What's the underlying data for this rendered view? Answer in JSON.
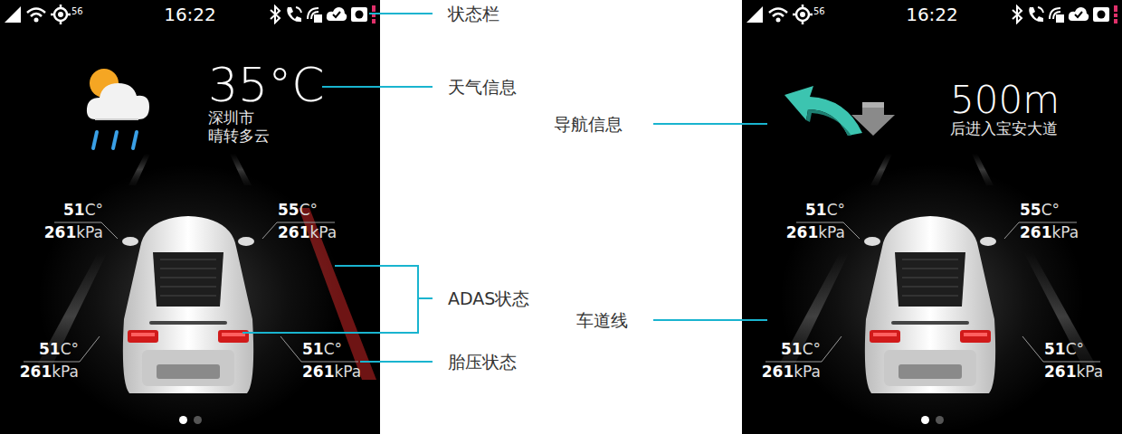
{
  "screens": [
    {
      "status_bar": {
        "signal": "56",
        "time": "16:22"
      },
      "info": {
        "kind": "weather",
        "main": "35°C",
        "lines": [
          "深圳市",
          "晴转多云"
        ]
      },
      "tires": [
        {
          "temp": "51",
          "temp_unit": "C°",
          "pressure": "261",
          "pressure_unit": "kPa"
        },
        {
          "temp": "55",
          "temp_unit": "C°",
          "pressure": "261",
          "pressure_unit": "kPa"
        },
        {
          "temp": "51",
          "temp_unit": "C°",
          "pressure": "261",
          "pressure_unit": "kPa"
        },
        {
          "temp": "51",
          "temp_unit": "C°",
          "pressure": "261",
          "pressure_unit": "kPa"
        }
      ],
      "lane_warning": true,
      "pager": [
        {
          "selected": true
        },
        {
          "selected": false
        }
      ]
    },
    {
      "status_bar": {
        "signal": "56",
        "time": "16:22"
      },
      "info": {
        "kind": "navigation",
        "main": "500m",
        "lines": [
          "后进入宝安大道"
        ]
      },
      "tires": [
        {
          "temp": "51",
          "temp_unit": "C°",
          "pressure": "261",
          "pressure_unit": "kPa"
        },
        {
          "temp": "55",
          "temp_unit": "C°",
          "pressure": "261",
          "pressure_unit": "kPa"
        },
        {
          "temp": "51",
          "temp_unit": "C°",
          "pressure": "261",
          "pressure_unit": "kPa"
        },
        {
          "temp": "51",
          "temp_unit": "C°",
          "pressure": "261",
          "pressure_unit": "kPa"
        }
      ],
      "lane_warning": false,
      "pager": [
        {
          "selected": true
        },
        {
          "selected": false
        }
      ]
    }
  ],
  "annotations": [
    {
      "label": "状态栏"
    },
    {
      "label": "天气信息"
    },
    {
      "label": "导航信息"
    },
    {
      "label": "ADAS状态"
    },
    {
      "label": "车道线"
    },
    {
      "label": "胎压状态"
    }
  ]
}
